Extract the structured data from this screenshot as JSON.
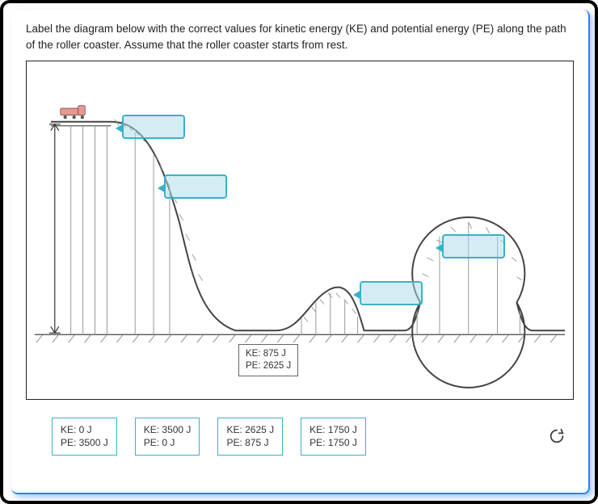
{
  "prompt": "Label the diagram below with the correct values for kinetic energy (KE) and potential energy (PE) along the path of the roller coaster. Assume that the roller coaster starts from rest.",
  "placed": {
    "ke_line": "KE: 875 J",
    "pe_line": "PE: 2625 J"
  },
  "tiles": [
    {
      "ke": "KE: 0 J",
      "pe": "PE: 3500 J"
    },
    {
      "ke": "KE: 3500 J",
      "pe": "PE: 0 J"
    },
    {
      "ke": "KE: 2625 J",
      "pe": "PE: 875 J"
    },
    {
      "ke": "KE: 1750 J",
      "pe": "PE: 1750 J"
    }
  ],
  "icons": {
    "reset": "reset-icon"
  }
}
